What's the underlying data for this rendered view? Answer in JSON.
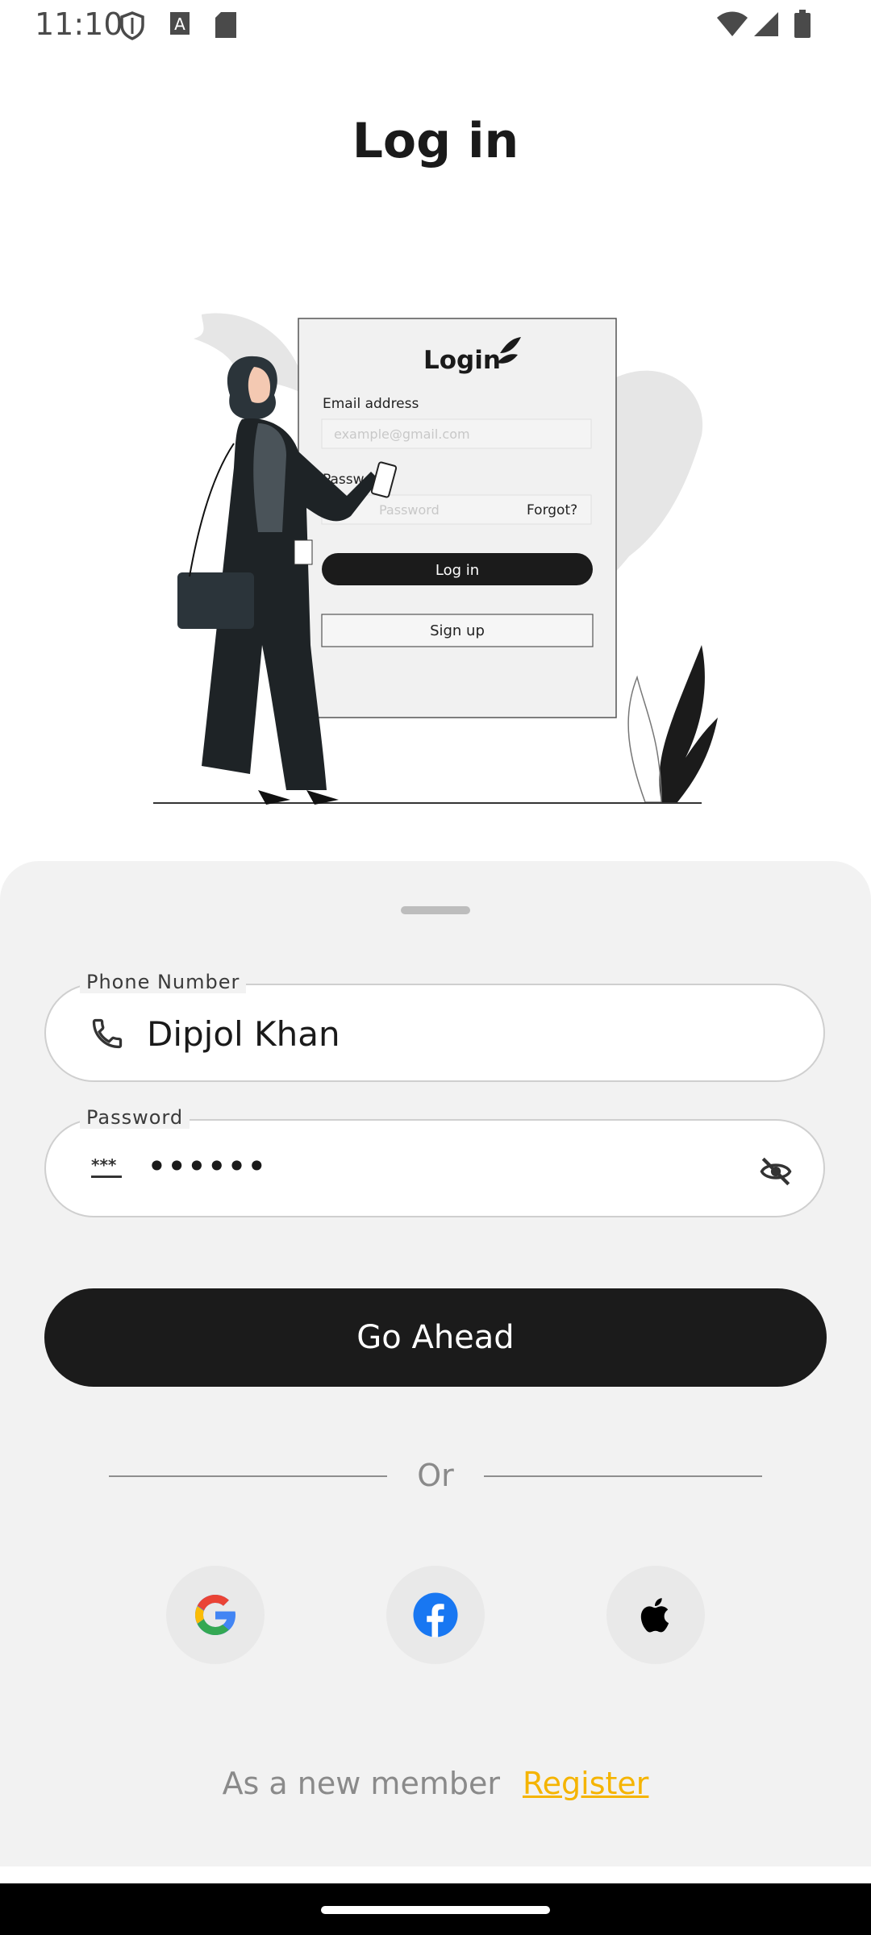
{
  "status_bar": {
    "time": "11:10"
  },
  "page": {
    "title": "Log in"
  },
  "illustration": {
    "card_title": "Login",
    "email_label": "Email address",
    "email_placeholder": "example@gmail.com",
    "password_label": "Password",
    "password_placeholder": "Password",
    "forgot_label": "Forgot?",
    "login_label": "Log in",
    "signup_label": "Sign up"
  },
  "form": {
    "phone_label": "Phone Number",
    "phone_value": "Dipjol Khan",
    "password_label": "Password",
    "password_value": "••••••",
    "submit_label": "Go Ahead"
  },
  "divider": {
    "text": "Or"
  },
  "social": {
    "providers": [
      "google-icon",
      "facebook-icon",
      "apple-icon"
    ]
  },
  "footer": {
    "member_text": "As a new member",
    "register_label": "Register"
  },
  "colors": {
    "accent": "#f5b400",
    "button": "#1b1b1b",
    "sheet": "#f2f2f2",
    "facebook": "#1877f2"
  }
}
